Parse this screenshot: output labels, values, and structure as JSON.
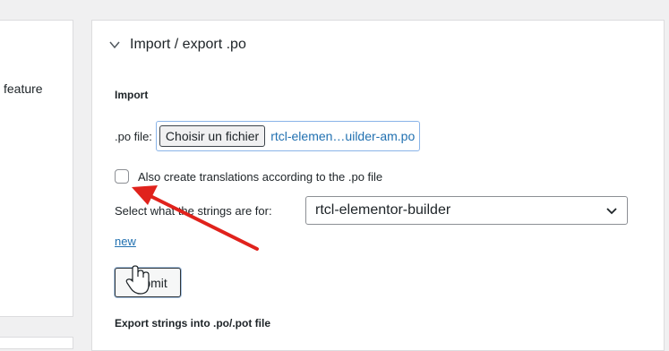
{
  "left_panel": {
    "fragment": "feature"
  },
  "section": {
    "title": "Import / export .po",
    "import_heading": "Import",
    "po_file_label": ".po file:",
    "choose_file_button": "Choisir un fichier",
    "chosen_file_name": "rtcl-elemen…uilder-am.po",
    "checkbox_label": "Also create translations according to the .po file",
    "select_label": "Select what the strings are for:",
    "select_value": "rtcl-elementor-builder",
    "new_link": "new",
    "submit_label": "Submit",
    "export_heading": "Export strings into .po/.pot file"
  },
  "colors": {
    "arrow": "#e0221c",
    "link": "#2271b1"
  },
  "icons": [
    "chevron-down-icon",
    "annotation-arrow-icon",
    "mouse-hand-cursor-icon"
  ]
}
